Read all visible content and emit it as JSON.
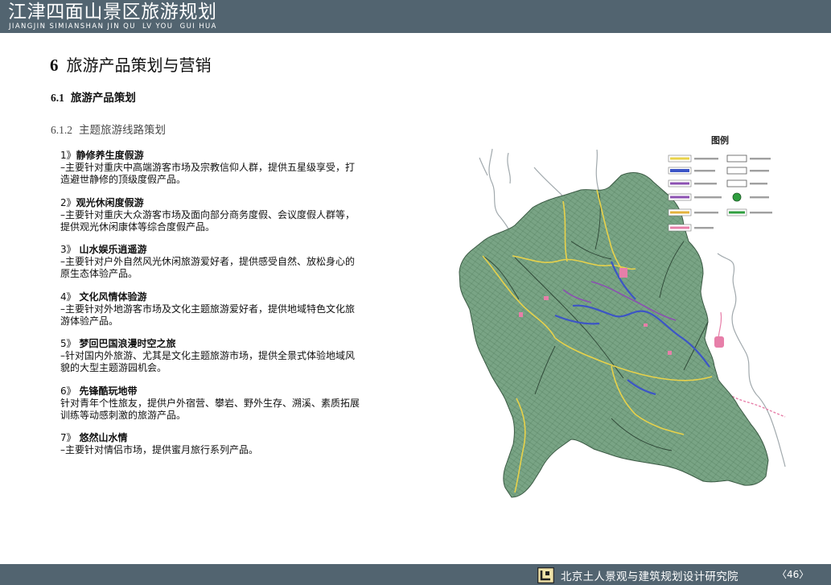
{
  "theme": {
    "bar": "#526470"
  },
  "header": {
    "title": "江津四面山景区旅游规划",
    "subtitle": "JIANGJIN SIMIANSHAN JIN QU  LV YOU  GUI HUA"
  },
  "chapter": {
    "number": "6",
    "title": "旅游产品策划与营销"
  },
  "section": {
    "number": "6.1",
    "title": "旅游产品策划"
  },
  "subsection": {
    "number": "6.1.2",
    "title": "主题旅游线路策划"
  },
  "items": [
    {
      "index": "1》",
      "title": "静修养生度假游",
      "lines": [
        "–主要针对重庆中高端游客市场及宗教信仰人群，提供五星级享受，打",
        "造避世静修的顶级度假产品。"
      ]
    },
    {
      "index": "2》",
      "title": "观光休闲度假游",
      "lines": [
        "–主要针对重庆大众游客市场及面向部分商务度假、会议度假人群等，",
        "提供观光休闲康体等综合度假产品。"
      ]
    },
    {
      "index": "3》 ",
      "title": "山水娱乐逍遥游",
      "lines": [
        "–主要针对户外自然风光休闲旅游爱好者，提供感受自然、放松身心的",
        "原生态体验产品。"
      ]
    },
    {
      "index": "4》 ",
      "title": "文化风情体验游",
      "lines": [
        "–主要针对外地游客市场及文化主题旅游爱好者，提供地域特色文化旅",
        "游体验产品。"
      ]
    },
    {
      "index": "5》 ",
      "title": "梦回巴国浪漫时空之旅",
      "lines": [
        "–针对国内外旅游、尤其是文化主题旅游市场，提供全景式体验地域风",
        "貌的大型主题游园机会。"
      ]
    },
    {
      "index": "6》 ",
      "title": "先锋酷玩地带",
      "lines": [
        "针对青年个性旅友，提供户外宿营、攀岩、野外生存、溯溪、素质拓展",
        "训练等动感刺激的旅游产品。"
      ]
    },
    {
      "index": "7》 ",
      "title": "悠然山水情",
      "lines": [
        "–主要针对情侣市场，提供蜜月旅行系列产品。"
      ]
    }
  ],
  "map": {
    "legend_title": "图例",
    "colors": {
      "land": "#79a485",
      "land_edge": "#3b5a44",
      "yellow_route": "#e8d24a",
      "blue_route": "#3c55c6",
      "purple_route": "#8b50b2",
      "orange_route": "#e3b23c",
      "pink_area": "#e77fa9",
      "dark_line": "#2d4535",
      "green_point": "#2f9e3f",
      "outer_river": "#a1a9ad"
    }
  },
  "footer": {
    "organization": "北京土人景观与建筑规划设计研究院",
    "page_number": "〈46〉"
  }
}
